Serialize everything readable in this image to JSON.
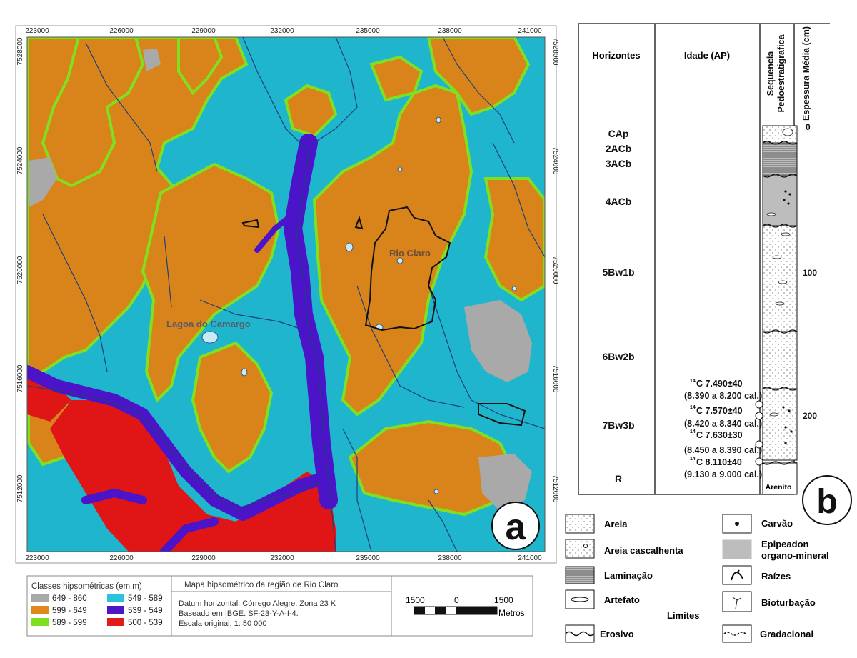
{
  "map": {
    "x_ticks": [
      "223000",
      "226000",
      "229000",
      "232000",
      "235000",
      "238000",
      "241000"
    ],
    "y_ticks": [
      "7528000",
      "7524000",
      "7520000",
      "7516000",
      "7512000"
    ],
    "places": {
      "rio_claro": "Rio Claro",
      "lagoa": "Lagoa do Camargo"
    },
    "panel_letter": "a",
    "colors": {
      "c649_860": "#a9a9a9",
      "c599_649": "#d9841b",
      "c589_599": "#80e020",
      "c549_589": "#1fb5cc",
      "c539_549": "#4b14c8",
      "c500_539": "#e01616",
      "river": "#1f3f7a",
      "outline": "#111111"
    },
    "legend": {
      "title": "Classes hipsométricas (em m)",
      "classes": [
        {
          "label": "649 - 860",
          "color": "#a9a9a9"
        },
        {
          "label": "599 - 649",
          "color": "#e08a1e"
        },
        {
          "label": "589 - 599",
          "color": "#7ee01e"
        },
        {
          "label": "549 - 589",
          "color": "#2bc3dc"
        },
        {
          "label": "539 - 549",
          "color": "#4b17c8"
        },
        {
          "label": "500 - 539",
          "color": "#e21a1a"
        }
      ]
    },
    "info": {
      "title": "Mapa hipsométrico da região de Rio Claro",
      "lines": [
        "Datum horizontal: Córrego Alegre. Zona 23 K",
        "Baseado em IBGE: SF-23-Y-A-I-4.",
        "Escala original: 1: 50 000"
      ]
    },
    "scale": {
      "left": "1500",
      "mid": "0",
      "right": "1500",
      "unit": "Metros"
    }
  },
  "strat": {
    "panel_letter": "b",
    "headers": {
      "horizontes": "Horizontes",
      "idade": "Idade (AP)",
      "sequencia": "Sequencia Pedoestratigrafica",
      "espessura": "Espessura Média (cm)"
    },
    "horizons": [
      "CAp",
      "2ACb",
      "3ACb",
      "4ACb",
      "5Bw1b",
      "6Bw2b",
      "7Bw3b",
      "R"
    ],
    "depth_ticks": [
      "0",
      "100",
      "200"
    ],
    "ages": [
      {
        "c14": "14",
        "value": "C 7.490±40",
        "cal": "(8.390 a 8.200 cal.)"
      },
      {
        "c14": "14",
        "value": "C 7.570±40",
        "cal": "(8.420 a 8.340 cal.)"
      },
      {
        "c14": "14",
        "value": "C 7.630±30",
        "cal": "(8.450 a 8.390 cal.)"
      },
      {
        "c14": "14",
        "value": "C 8.110±40",
        "cal": "(9.130 a 9.000 cal.)"
      }
    ],
    "bedrock": "Arenito",
    "legend": {
      "areia": "Areia",
      "areia_cascalhenta": "Areia cascalhenta",
      "laminacao": "Laminação",
      "artefato": "Artefato",
      "carvao": "Carvão",
      "epipeadon": [
        "Epipeadon",
        "organo-mineral"
      ],
      "raizes": "Raízes",
      "bioturbacao": "Bioturbação",
      "limites": "Limites",
      "erosivo": "Erosivo",
      "gradacional": "Gradacional"
    }
  }
}
